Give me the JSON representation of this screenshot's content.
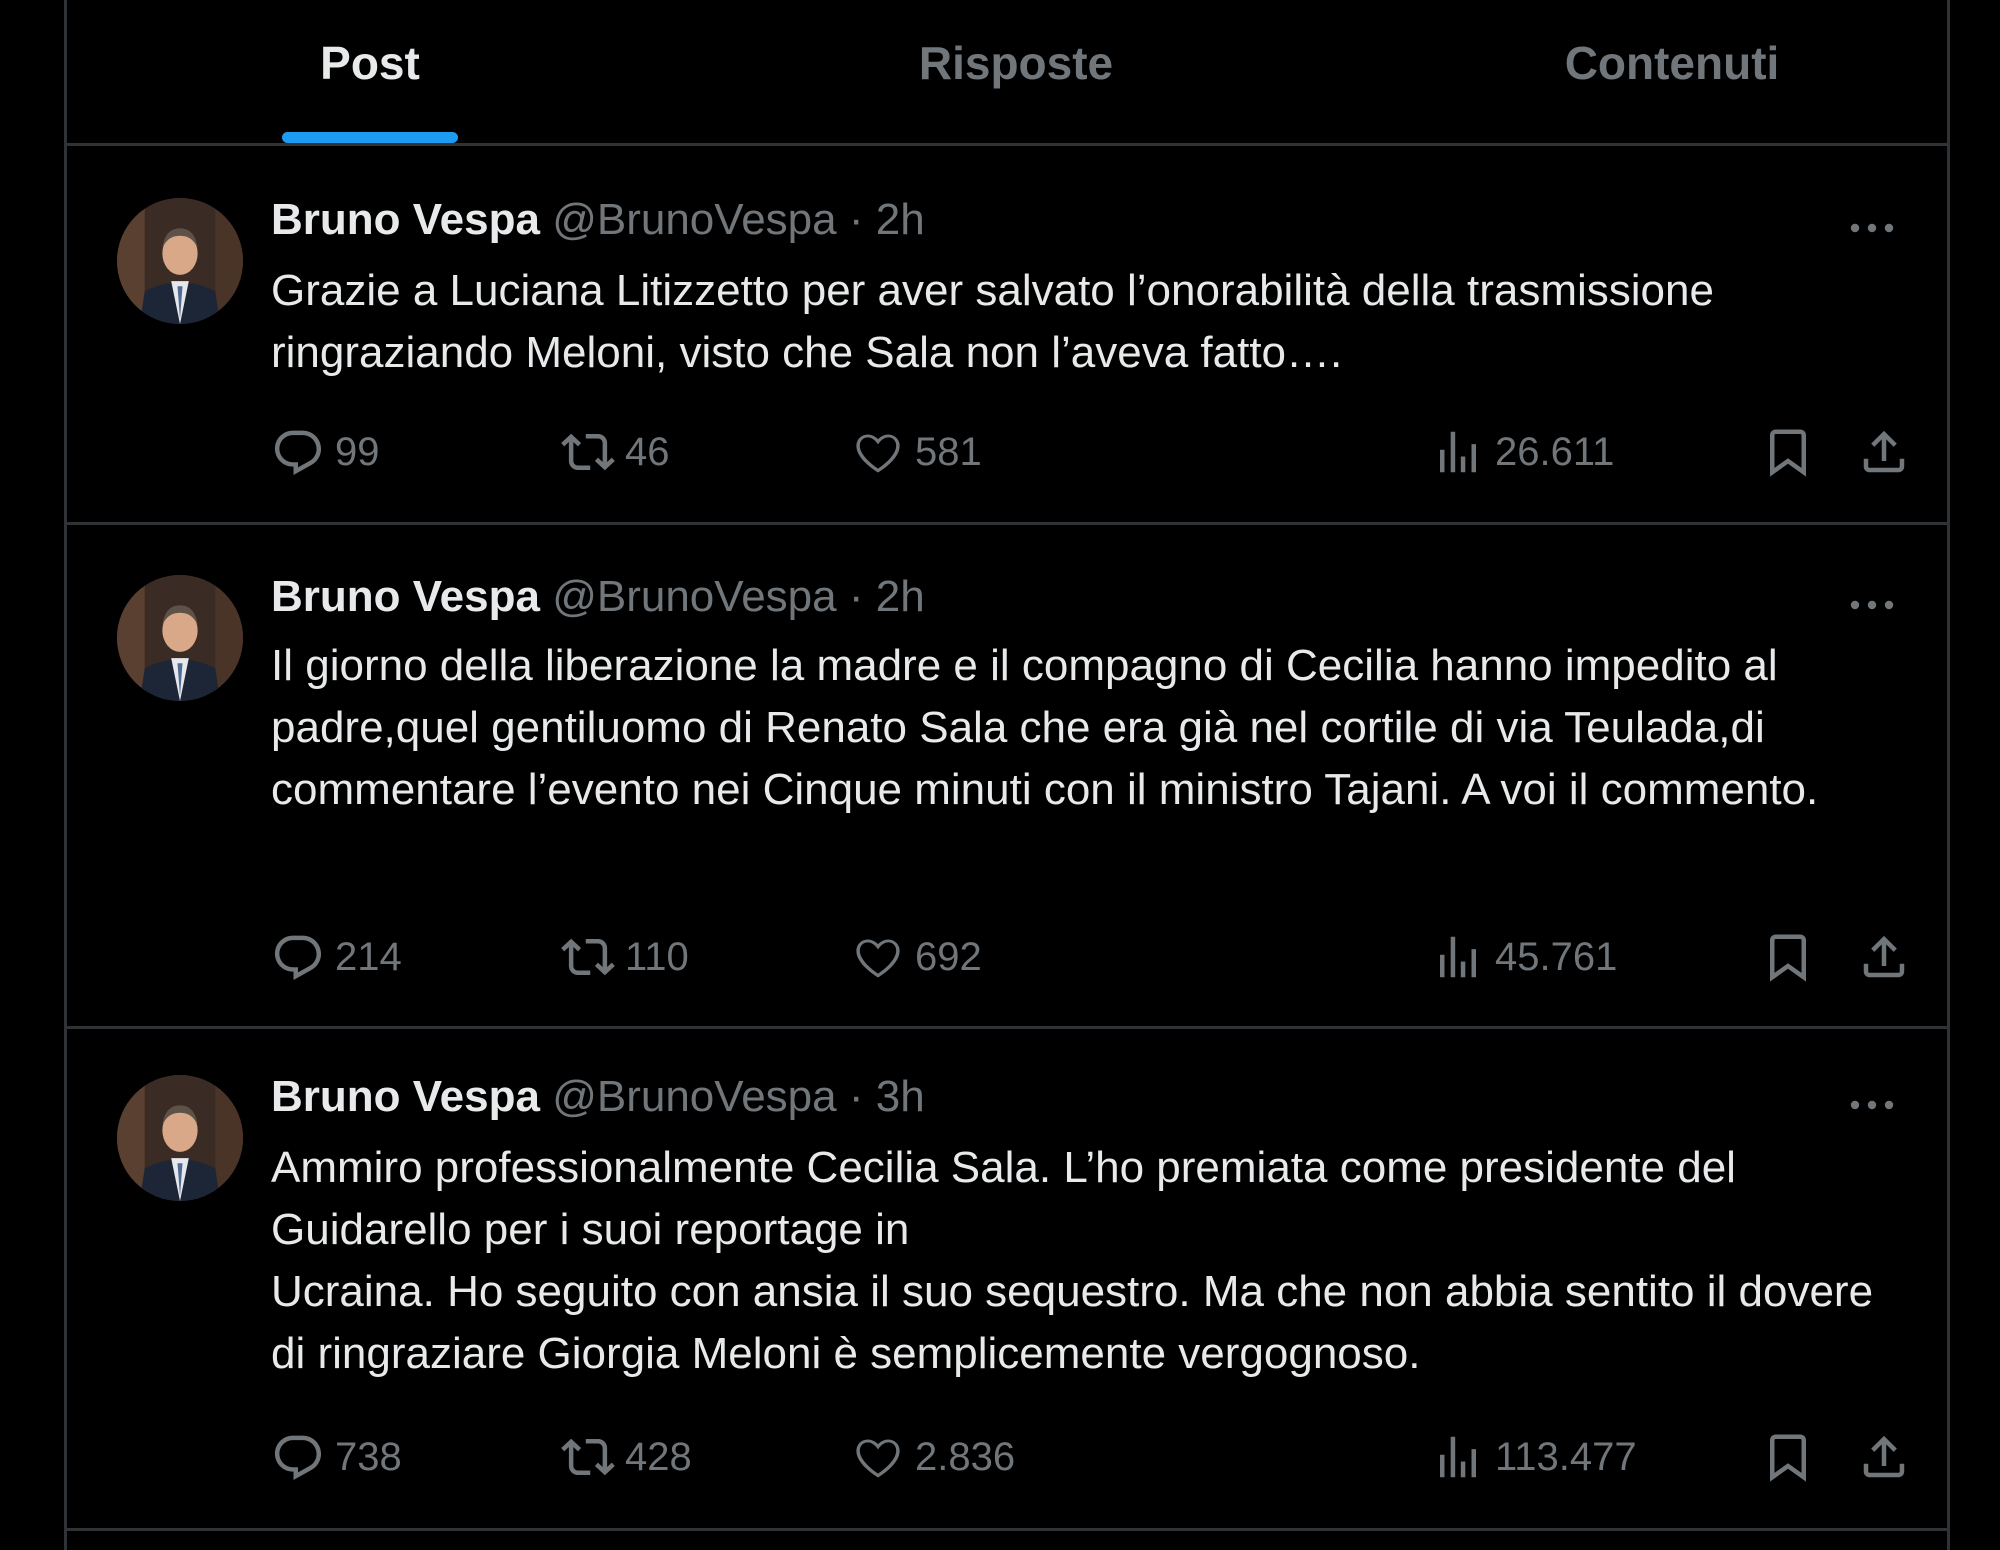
{
  "tabs": [
    {
      "label": "Post",
      "active": true
    },
    {
      "label": "Risposte",
      "active": false
    },
    {
      "label": "Contenuti",
      "active": false
    }
  ],
  "tweets": [
    {
      "name": "Bruno Vespa",
      "handle": "@BrunoVespa",
      "separator": "·",
      "time": "2h",
      "lines": [
        "Grazie a Luciana Litizzetto per aver salvato l’onorabilità della trasmissione ringraziando Meloni, visto che Sala non l’aveva fatto…."
      ],
      "replies": "99",
      "reposts": "46",
      "likes": "581",
      "views": "26.611"
    },
    {
      "name": "Bruno Vespa",
      "handle": "@BrunoVespa",
      "separator": "·",
      "time": "2h",
      "lines": [
        "Il giorno della liberazione la madre e il compagno di Cecilia hanno impedito al padre,quel gentiluomo di Renato Sala che era già nel cortile di via Teulada,di commentare l’evento nei Cinque minuti con il ministro Tajani. A voi il commento."
      ],
      "replies": "214",
      "reposts": "110",
      "likes": "692",
      "views": "45.761"
    },
    {
      "name": "Bruno Vespa",
      "handle": "@BrunoVespa",
      "separator": "·",
      "time": "3h",
      "lines": [
        "Ammiro professionalmente Cecilia Sala. L’ho premiata come presidente del Guidarello per i suoi reportage in",
        "Ucraina. Ho seguito con ansia il suo sequestro. Ma che non abbia sentito il dovere di ringraziare Giorgia Meloni è semplicemente vergognoso."
      ],
      "replies": "738",
      "reposts": "428",
      "likes": "2.836",
      "views": "113.477"
    }
  ],
  "icons": {
    "reply": "speech-bubble-icon",
    "repost": "repost-arrows-icon",
    "like": "heart-icon",
    "views": "bar-chart-icon",
    "bookmark": "bookmark-icon",
    "share": "share-upload-icon",
    "more": "ellipsis-icon"
  },
  "colors": {
    "background": "#000000",
    "text": "#e7e9ea",
    "muted": "#71767b",
    "accent": "#1d9bf0",
    "border": "#2f3336"
  }
}
